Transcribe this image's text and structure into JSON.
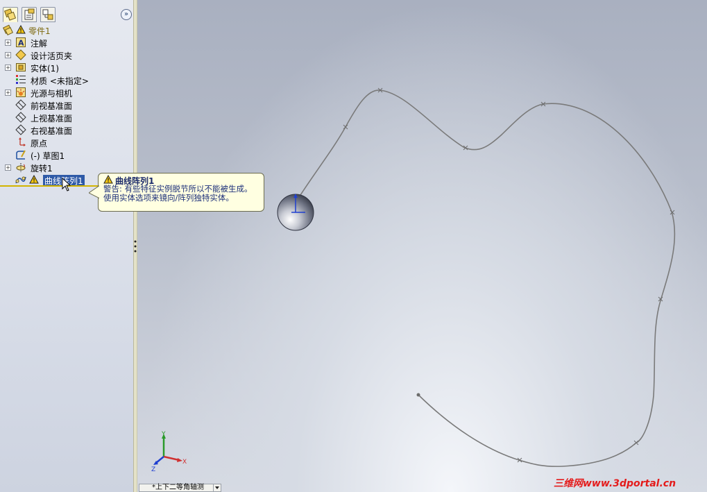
{
  "feature_tree": {
    "root": "零件1",
    "items": [
      {
        "label": "注解",
        "icon": "annotation-icon",
        "expandable": true
      },
      {
        "label": "设计活页夹",
        "icon": "design-binder-icon",
        "expandable": true
      },
      {
        "label": "实体(1)",
        "icon": "solid-bodies-icon",
        "expandable": true
      },
      {
        "label": "材质 <未指定>",
        "icon": "material-icon",
        "expandable": false
      },
      {
        "label": "光源与相机",
        "icon": "lights-cameras-icon",
        "expandable": true
      },
      {
        "label": "前视基准面",
        "icon": "plane-icon",
        "expandable": false
      },
      {
        "label": "上视基准面",
        "icon": "plane-icon",
        "expandable": false
      },
      {
        "label": "右视基准面",
        "icon": "plane-icon",
        "expandable": false
      },
      {
        "label": "原点",
        "icon": "origin-icon",
        "expandable": false
      },
      {
        "label": "(-) 草图1",
        "icon": "sketch-icon",
        "expandable": false
      },
      {
        "label": "旋转1",
        "icon": "revolve-icon",
        "expandable": true
      }
    ],
    "selected": "曲线阵列1"
  },
  "tooltip": {
    "title": "曲线阵列1",
    "body": "警告: 有些特征实例脱节所以不能被生成。使用实体选项来镜向/阵列独特实体。"
  },
  "triad": {
    "x": "X",
    "y": "Y",
    "z": "Z"
  },
  "view_selector": {
    "label": "*上下二等角轴测"
  },
  "watermark": "三维网www.3dportal.cn",
  "colors": {
    "selection": "#2f5aa7",
    "warning": "#f1c40f",
    "insert_bar": "#d2b400"
  }
}
